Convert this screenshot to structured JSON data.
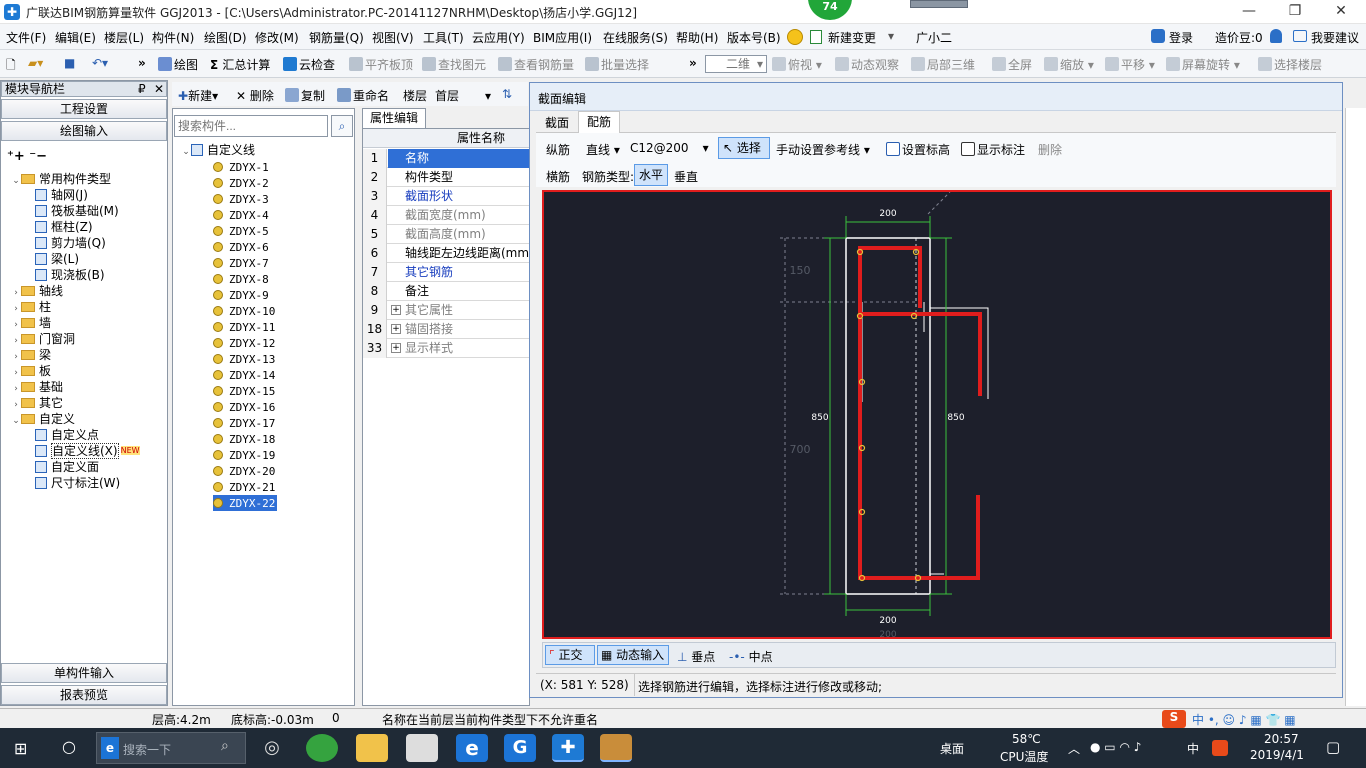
{
  "window": {
    "title": "广联达BIM钢筋算量软件 GGJ2013 - [C:\\Users\\Administrator.PC-20141127NRHM\\Desktop\\扬店小学.GGJ12]",
    "badge": "74",
    "min": "—",
    "restore": "❐",
    "close": "✕"
  },
  "menu": {
    "items": [
      "文件(F)",
      "编辑(E)",
      "楼层(L)",
      "构件(N)",
      "绘图(D)",
      "修改(M)",
      "钢筋量(Q)",
      "视图(V)",
      "工具(T)",
      "云应用(Y)",
      "BIM应用(I)",
      "在线服务(S)",
      "帮助(H)",
      "版本号(B)"
    ],
    "new_change": "新建变更",
    "user": "广小二",
    "login": "登录",
    "price_bean": "造价豆:0",
    "suggest": "我要建议"
  },
  "toolbar": {
    "draw": "绘图",
    "sum": "汇总计算",
    "cloud_check": "云检查",
    "flush_top": "平齐板顶",
    "find_elem": "查找图元",
    "view_rebar": "查看钢筋量",
    "batch_select": "批量选择",
    "view_mode": "二维",
    "top_view": "俯视",
    "dynamic": "动态观察",
    "local_3d": "局部三维",
    "fullscreen": "全屏",
    "zoom": "缩放",
    "pan": "平移",
    "rotate": "屏幕旋转",
    "select_floor": "选择楼层"
  },
  "leftnav": {
    "title": "模块导航栏",
    "pin": "₽",
    "close": "✕",
    "project_settings": "工程设置",
    "drawing_input": "绘图输入",
    "tree": [
      {
        "label": "常用构件类型",
        "level": 0,
        "type": "folder",
        "open": true
      },
      {
        "label": "轴网(J)",
        "level": 1,
        "type": "comp"
      },
      {
        "label": "筏板基础(M)",
        "level": 1,
        "type": "comp"
      },
      {
        "label": "框柱(Z)",
        "level": 1,
        "type": "comp"
      },
      {
        "label": "剪力墙(Q)",
        "level": 1,
        "type": "comp"
      },
      {
        "label": "梁(L)",
        "level": 1,
        "type": "comp"
      },
      {
        "label": "现浇板(B)",
        "level": 1,
        "type": "comp"
      },
      {
        "label": "轴线",
        "level": 0,
        "type": "folder"
      },
      {
        "label": "柱",
        "level": 0,
        "type": "folder"
      },
      {
        "label": "墙",
        "level": 0,
        "type": "folder"
      },
      {
        "label": "门窗洞",
        "level": 0,
        "type": "folder"
      },
      {
        "label": "梁",
        "level": 0,
        "type": "folder"
      },
      {
        "label": "板",
        "level": 0,
        "type": "folder"
      },
      {
        "label": "基础",
        "level": 0,
        "type": "folder"
      },
      {
        "label": "其它",
        "level": 0,
        "type": "folder"
      },
      {
        "label": "自定义",
        "level": 0,
        "type": "folder",
        "open": true
      },
      {
        "label": "自定义点",
        "level": 1,
        "type": "comp"
      },
      {
        "label": "自定义线(X)",
        "level": 1,
        "type": "comp",
        "selected": true
      },
      {
        "label": "自定义面",
        "level": 1,
        "type": "comp"
      },
      {
        "label": "尺寸标注(W)",
        "level": 1,
        "type": "comp"
      }
    ],
    "new_badge": "NEW",
    "single_input": "单构件输入",
    "report_preview": "报表预览"
  },
  "components": {
    "new": "新建",
    "delete": "删除",
    "copy": "复制",
    "rename": "重命名",
    "floor_label": "楼层",
    "floor_value": "首层",
    "search_placeholder": "搜索构件...",
    "root": "自定义线",
    "items": [
      "ZDYX-1",
      "ZDYX-2",
      "ZDYX-3",
      "ZDYX-4",
      "ZDYX-5",
      "ZDYX-6",
      "ZDYX-7",
      "ZDYX-8",
      "ZDYX-9",
      "ZDYX-10",
      "ZDYX-11",
      "ZDYX-12",
      "ZDYX-13",
      "ZDYX-14",
      "ZDYX-15",
      "ZDYX-16",
      "ZDYX-17",
      "ZDYX-18",
      "ZDYX-19",
      "ZDYX-20",
      "ZDYX-21",
      "ZDYX-22"
    ],
    "selected": "ZDYX-22"
  },
  "props": {
    "tab": "属性编辑",
    "header": "属性名称",
    "rows": [
      {
        "num": "1",
        "name": "名称",
        "style": "selected"
      },
      {
        "num": "2",
        "name": "构件类型",
        "style": "normal"
      },
      {
        "num": "3",
        "name": "截面形状",
        "style": "blue"
      },
      {
        "num": "4",
        "name": "截面宽度(mm)",
        "style": "gray"
      },
      {
        "num": "5",
        "name": "截面高度(mm)",
        "style": "gray"
      },
      {
        "num": "6",
        "name": "轴线距左边线距离(mm)",
        "style": "normal"
      },
      {
        "num": "7",
        "name": "其它钢筋",
        "style": "blue"
      },
      {
        "num": "8",
        "name": "备注",
        "style": "normal"
      },
      {
        "num": "9",
        "name": "其它属性",
        "style": "group"
      },
      {
        "num": "18",
        "name": "锚固搭接",
        "style": "group"
      },
      {
        "num": "33",
        "name": "显示样式",
        "style": "group"
      }
    ]
  },
  "dialog": {
    "title": "截面编辑",
    "tabs": [
      "截面",
      "配筋"
    ],
    "active_tab": "配筋",
    "longitudinal": "纵筋",
    "line_type": "直线",
    "rebar_spec": "C12@200",
    "select": "选择",
    "manual_ref": "手动设置参考线",
    "set_elevation": "设置标高",
    "show_label": "显示标注",
    "delete": "删除",
    "transverse": "横筋",
    "rebar_type_label": "钢筋类型:",
    "horizontal": "水平",
    "vertical": "垂直",
    "ortho": "正交",
    "dyn_input": "动态输入",
    "perp_point": "垂点",
    "mid_point": "中点",
    "coords": "(X: 581 Y: 528)",
    "hint": "选择钢筋进行编辑，选择标注进行修改或移动;",
    "dims": {
      "top_width": "200",
      "bottom_width": "200",
      "bottom_width2": "200",
      "left_height": "850",
      "right_height": "850",
      "left_top": "150",
      "left_mid": "700"
    }
  },
  "status": {
    "floor_height": "层高:4.2m",
    "base_elev": "底标高:-0.03m",
    "zero": "0",
    "message": "名称在当前层当前构件类型下不允许重名"
  },
  "taskbar": {
    "search": "搜索一下",
    "desktop": "桌面",
    "temp": "58℃",
    "cpu": "CPU温度",
    "ime": "中",
    "time": "20:57",
    "date": "2019/4/1"
  },
  "colors": {
    "rebar": "#e01d1d",
    "canvas_bg": "#1d1f2b",
    "outline": "#ffffff",
    "dimension": "#3cc23c",
    "node": "#e8c23a"
  }
}
